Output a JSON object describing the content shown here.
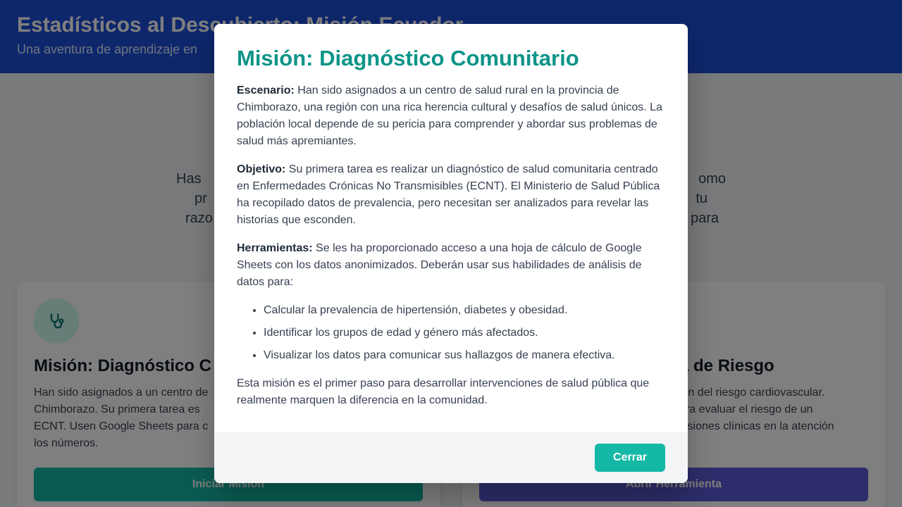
{
  "header": {
    "title": "Estadísticos al Descubierto: Misión Ecuador",
    "subtitle": "Una aventura de aprendizaje en"
  },
  "intro": {
    "line1_left": "Has",
    "line1_right": "omo",
    "line2_left": "pr",
    "line2_right": "tu",
    "line3_left": "razo",
    "line3_right": "para"
  },
  "cards": [
    {
      "icon": "stethoscope-icon",
      "title": "Misión: Diagnóstico C",
      "text": "Han sido asignados a un centro de\nChimborazo. Su primera tarea es\nECNT. Usen Google Sheets para c\nlos números.",
      "button": "Iniciar Misión"
    },
    {
      "icon": "heart-icon",
      "title": "a de Riesgo",
      "text": "ión del riesgo cardiovascular.\nara evaluar el riesgo de un\ncisiones clínicas en la atención",
      "button": "Abrir Herramienta"
    }
  ],
  "modal": {
    "title": "Misión: Diagnóstico Comunitario",
    "scenario_label": "Escenario:",
    "scenario_text": " Han sido asignados a un centro de salud rural en la provincia de Chimborazo, una región con una rica herencia cultural y desafíos de salud únicos. La población local depende de su pericia para comprender y abordar sus problemas de salud más apremiantes.",
    "objective_label": "Objetivo:",
    "objective_text": " Su primera tarea es realizar un diagnóstico de salud comunitaria centrado en Enfermedades Crónicas No Transmisibles (ECNT). El Ministerio de Salud Pública ha recopilado datos de prevalencia, pero necesitan ser analizados para revelar las historias que esconden.",
    "tools_label": "Herramientas:",
    "tools_text": " Se les ha proporcionado acceso a una hoja de cálculo de Google Sheets con los datos anonimizados. Deberán usar sus habilidades de análisis de datos para:",
    "tasks": [
      "Calcular la prevalencia de hipertensión, diabetes y obesidad.",
      "Identificar los grupos de edad y género más afectados.",
      "Visualizar los datos para comunicar sus hallazgos de manera efectiva."
    ],
    "closing": "Esta misión es el primer paso para desarrollar intervenciones de salud pública que realmente marquen la diferencia en la comunidad.",
    "close_button": "Cerrar"
  }
}
